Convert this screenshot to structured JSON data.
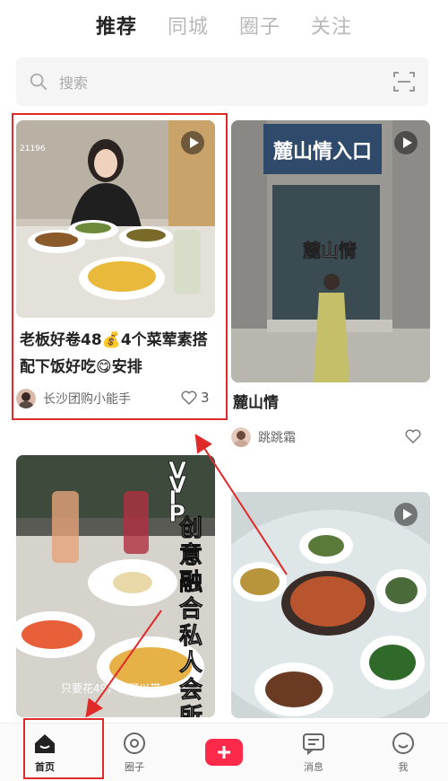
{
  "top_tabs": [
    {
      "label": "推荐"
    },
    {
      "label": "同城"
    },
    {
      "label": "圈子"
    },
    {
      "label": "关注"
    }
  ],
  "search": {
    "placeholder": "搜索"
  },
  "cards": [
    {
      "title_line1": "老板好卷48💰4个菜荤素搭",
      "title_line2": "配下饭好吃😋安排",
      "author": "长沙团购小能手",
      "likes": "3",
      "thumb_text": "21196"
    },
    {
      "sign_text": "麓山情入口",
      "overlay_text": "麓山情",
      "title": "麓山情",
      "author": "跳跳霜"
    },
    {
      "overlay_text": "VVIP创意融合私人会所",
      "caption": "只要花49，就可以带"
    },
    {}
  ],
  "bottom_nav": [
    {
      "label": "首页"
    },
    {
      "label": "圈子"
    },
    {
      "label": ""
    },
    {
      "label": "消息"
    },
    {
      "label": "我"
    }
  ],
  "colors": {
    "accent": "#ff2a4a",
    "highlight": "#e02a2a"
  }
}
